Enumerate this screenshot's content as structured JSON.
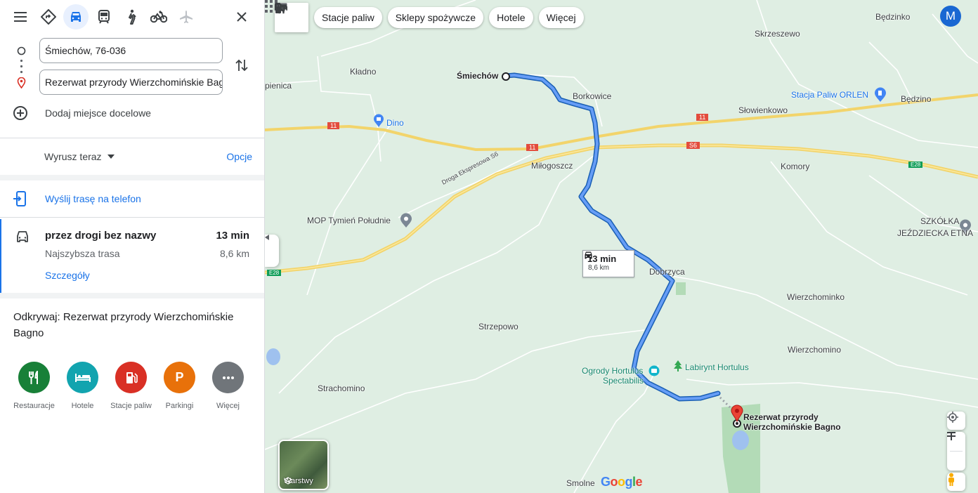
{
  "sidebar": {
    "modes": [
      "directions-icon",
      "car-icon",
      "transit-icon",
      "walk-icon",
      "bike-icon",
      "plane-icon"
    ],
    "origin": "Śmiechów, 76-036",
    "destination": "Rezerwat przyrody Wierzchomińskie Bagno",
    "add_destination": "Dodaj miejsce docelowe",
    "depart": "Wyrusz teraz",
    "options": "Opcje",
    "send_to_phone": "Wyślij trasę na telefon",
    "route": {
      "title": "przez drogi bez nazwy",
      "time": "13 min",
      "subtitle": "Najszybsza trasa",
      "distance": "8,6 km",
      "details": "Szczegóły"
    },
    "explore_title": "Odkrywaj: Rezerwat przyrody Wierzchomińskie Bagno",
    "categories": [
      {
        "label": "Restauracje",
        "color": "#188038"
      },
      {
        "label": "Hotele",
        "color": "#12a4af"
      },
      {
        "label": "Stacje paliw",
        "color": "#d93025"
      },
      {
        "label": "Parkingi",
        "color": "#e8710a",
        "glyph": "P"
      },
      {
        "label": "Więcej",
        "color": "#70757a"
      }
    ]
  },
  "chips": [
    "Stacje paliw",
    "Sklepy spożywcze",
    "Hotele",
    "Więcej"
  ],
  "avatar": "M",
  "map": {
    "labels": {
      "smiechow": "Śmiechów",
      "kladno": "Kładno",
      "pienica": "pienica",
      "borkowice": "Borkowice",
      "dino": "Dino",
      "milogoszcz": "Miłogoszcz",
      "mop": "MOP Tymień Południe",
      "dobrzyca": "Dobrzyca",
      "strzepowo": "Strzepowo",
      "strachomino": "Strachomino",
      "ogrody1": "Ogrody Hortulus",
      "ogrody2": "Spectabilis",
      "labirynt": "Labirynt Hortulus",
      "rezerwat1": "Rezerwat przyrody",
      "rezerwat2": "Wierzchomińskie Bagno",
      "wierzchominko": "Wierzchominko",
      "wierzchomino": "Wierzchomino",
      "komory": "Komory",
      "slowienkowo": "Słowienkowo",
      "orlen": "Stacja Paliw ORLEN",
      "bedzino": "Będzino",
      "bedzinko": "Będzinko",
      "skrzeszewo": "Skrzeszewo",
      "szkolka1": "SZKÓŁKA",
      "szkolka2": "JEŹDZIECKA ETNA",
      "smolne": "Smolne",
      "expressway": "Droga Ekspresowa S6",
      "shield_11a": "11",
      "shield_11b": "11",
      "shield_11c": "11",
      "shield_s6": "S6",
      "shield_e28a": "E28",
      "shield_e28b": "E28"
    },
    "time_box": {
      "time": "13 min",
      "distance": "8,6 km"
    },
    "layers": "Warstwy",
    "google": "Google"
  }
}
